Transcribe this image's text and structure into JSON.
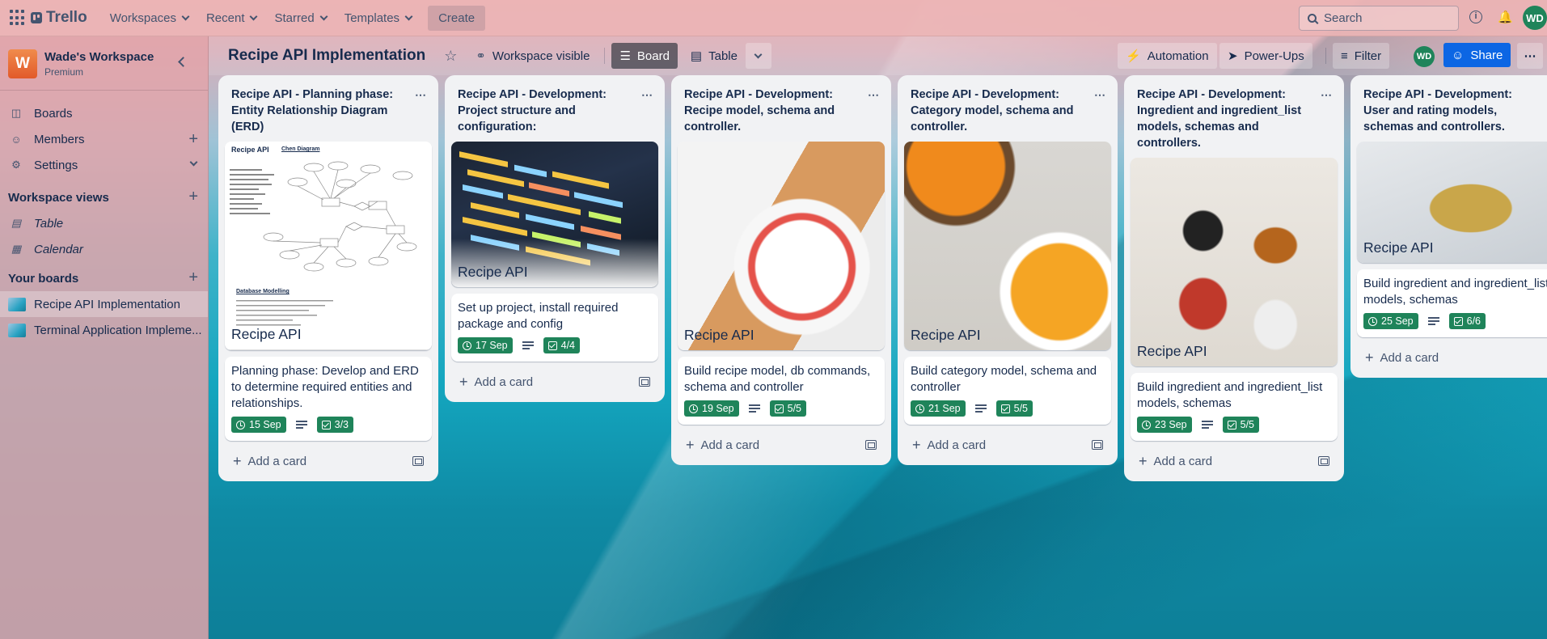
{
  "topnav": {
    "logo": "Trello",
    "menus": [
      "Workspaces",
      "Recent",
      "Starred",
      "Templates"
    ],
    "create": "Create",
    "search_placeholder": "Search",
    "user_initials": "WD"
  },
  "sidebar": {
    "workspace_initial": "W",
    "workspace_name": "Wade's Workspace",
    "workspace_plan": "Premium",
    "items": [
      {
        "label": "Boards",
        "icon": "trello-board-icon"
      },
      {
        "label": "Members",
        "icon": "person-icon"
      },
      {
        "label": "Settings",
        "icon": "gear-icon"
      }
    ],
    "views_heading": "Workspace views",
    "views": [
      {
        "label": "Table",
        "icon": "table-icon"
      },
      {
        "label": "Calendar",
        "icon": "calendar-icon"
      }
    ],
    "boards_heading": "Your boards",
    "boards": [
      {
        "label": "Recipe API Implementation",
        "active": true
      },
      {
        "label": "Terminal Application Impleme...",
        "active": false
      }
    ]
  },
  "board": {
    "title": "Recipe API Implementation",
    "visibility": "Workspace visible",
    "view_board": "Board",
    "view_table": "Table",
    "automation": "Automation",
    "powerups": "Power-Ups",
    "filter": "Filter",
    "member_initials": "WD",
    "share": "Share"
  },
  "add_card_label": "Add a card",
  "lists": [
    {
      "title": "Recipe API - Planning phase: Entity Relationship Diagram (ERD)",
      "cover_title": "Recipe API",
      "cover_caption_a": "Recipe API",
      "cover_caption_b": "Chen Diagram",
      "cover_caption_c": "Database Modelling",
      "card_title": "Planning phase: Develop and ERD to determine required entities and relationships.",
      "due": "15 Sep",
      "checklist": "3/3"
    },
    {
      "title": "Recipe API - Development: Project structure and configuration:",
      "cover_title": "Recipe API",
      "card_title": "Set up project, install required package and config",
      "due": "17 Sep",
      "checklist": "4/4"
    },
    {
      "title": "Recipe API - Development: Recipe model, schema and controller.",
      "cover_title": "Recipe API",
      "card_title": "Build recipe model, db commands, schema and controller",
      "due": "19 Sep",
      "checklist": "5/5"
    },
    {
      "title": "Recipe API - Development: Category model, schema and controller.",
      "cover_title": "Recipe API",
      "card_title": "Build category model, schema and controller",
      "due": "21 Sep",
      "checklist": "5/5"
    },
    {
      "title": "Recipe API - Development: Ingredient and ingredient_list models, schemas and controllers.",
      "cover_title": "Recipe API",
      "card_title": "Build ingredient and ingredient_list models, schemas",
      "due": "23 Sep",
      "checklist": "5/5"
    },
    {
      "title": "Recipe API - Development: User and rating models, schemas and controllers.",
      "cover_title": "Recipe API",
      "card_title": "Build ingredient and ingredient_list models, schemas",
      "due": "25 Sep",
      "checklist": "6/6"
    }
  ]
}
